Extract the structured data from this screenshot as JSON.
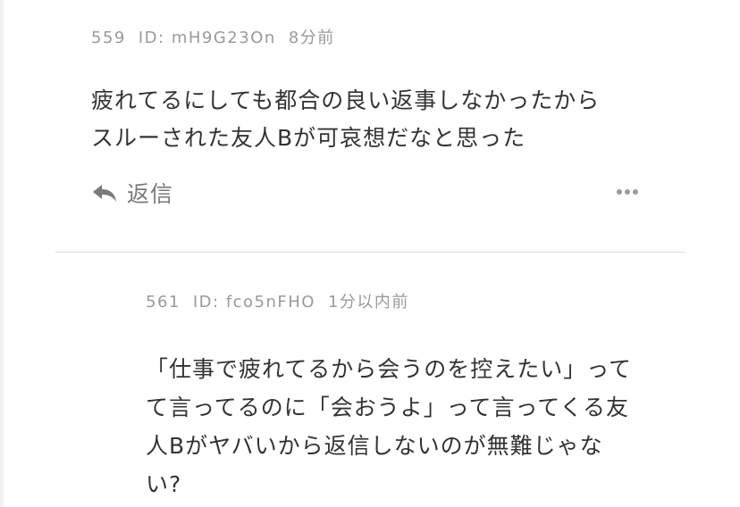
{
  "comments": [
    {
      "number": "559",
      "id_label": "ID: mH9G23On",
      "time": "8分前",
      "lines": [
        "疲れてるにしても都合の良い返事しなかったから",
        "スルーされた友人Bが可哀想だなと思った"
      ],
      "reply_label": "返信"
    },
    {
      "number": "561",
      "id_label": "ID: fco5nFHO",
      "time": "1分以内前",
      "lines": [
        "「仕事で疲れてるから会うのを控えたい」って",
        "て言ってるのに「会おうよ」って言ってくる友",
        "人Bがヤバいから返信しないのが無難じゃな",
        "い?"
      ]
    }
  ],
  "icons": {
    "reply": "reply-arrow-icon",
    "more": "more-dots-icon"
  },
  "colors": {
    "meta": "#9a9a9a",
    "text": "#333333",
    "reply": "#7a7a7a",
    "divider": "#dcdcdc"
  }
}
